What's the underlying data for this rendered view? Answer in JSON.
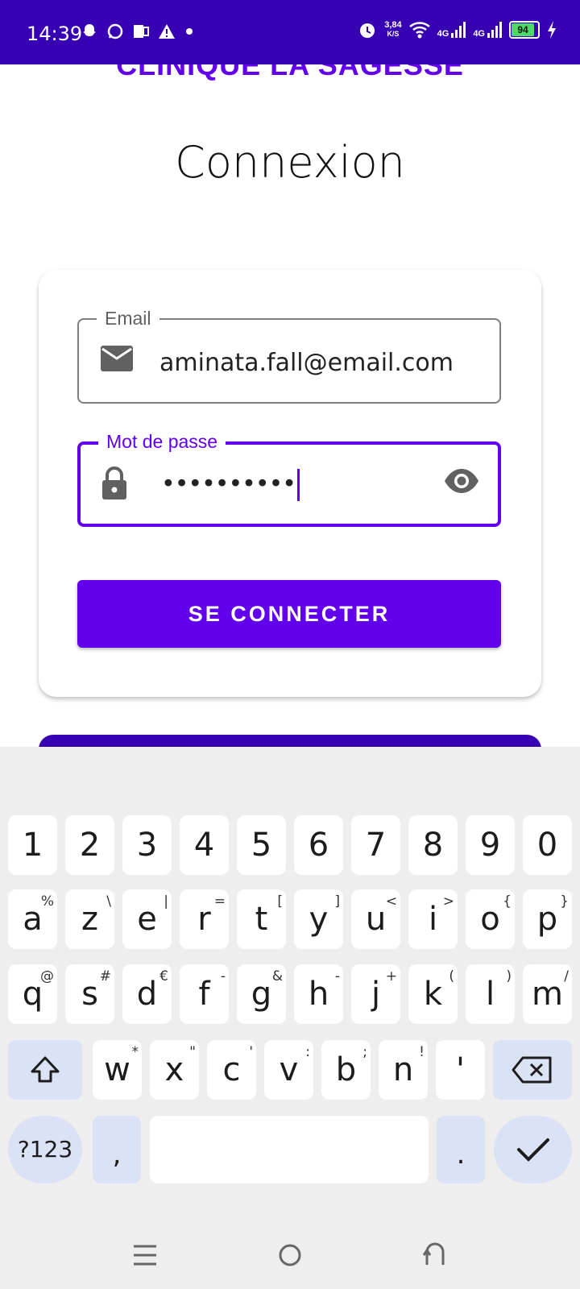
{
  "status_bar": {
    "time": "14:39",
    "net_speed_value": "3,84",
    "net_speed_unit": "K/S",
    "net1": "4G",
    "net2": "4G",
    "battery": "94",
    "icons_left": [
      "snapchat-icon",
      "whatsapp-icon",
      "outlook-icon",
      "warning-icon",
      "dot-icon"
    ],
    "icons_right": [
      "alarm-icon",
      "wifi-icon",
      "signal-icon",
      "signal-icon",
      "battery-icon",
      "charging-icon"
    ]
  },
  "app": {
    "brand": "CLINIQUE LA SAGESSE",
    "title": "Connexion",
    "email_label": "Email",
    "email_value": "aminata.fall@email.com",
    "password_label": "Mot de passe",
    "password_value": "••••••••••",
    "login_button": "SE CONNECTER",
    "accent_color": "#6200ee",
    "dark_accent_color": "#3700b3"
  },
  "keyboard": {
    "row_numbers": [
      "1",
      "2",
      "3",
      "4",
      "5",
      "6",
      "7",
      "8",
      "9",
      "0"
    ],
    "row1": [
      {
        "k": "a",
        "s": "%"
      },
      {
        "k": "z",
        "s": "\\"
      },
      {
        "k": "e",
        "s": "|"
      },
      {
        "k": "r",
        "s": "="
      },
      {
        "k": "t",
        "s": "["
      },
      {
        "k": "y",
        "s": "]"
      },
      {
        "k": "u",
        "s": "<"
      },
      {
        "k": "i",
        "s": ">"
      },
      {
        "k": "o",
        "s": "{"
      },
      {
        "k": "p",
        "s": "}"
      }
    ],
    "row2": [
      {
        "k": "q",
        "s": "@"
      },
      {
        "k": "s",
        "s": "#"
      },
      {
        "k": "d",
        "s": "€"
      },
      {
        "k": "f",
        "s": "-"
      },
      {
        "k": "g",
        "s": "&"
      },
      {
        "k": "h",
        "s": "-"
      },
      {
        "k": "j",
        "s": "+"
      },
      {
        "k": "k",
        "s": "("
      },
      {
        "k": "l",
        "s": ")"
      },
      {
        "k": "m",
        "s": "/"
      }
    ],
    "row3": [
      {
        "k": "w",
        "s": "*"
      },
      {
        "k": "x",
        "s": "\""
      },
      {
        "k": "c",
        "s": "'"
      },
      {
        "k": "v",
        "s": ":"
      },
      {
        "k": "b",
        "s": ";"
      },
      {
        "k": "n",
        "s": "!"
      },
      {
        "k": "'",
        "s": ""
      }
    ],
    "symbols_key": "?123",
    "comma_key": ",",
    "period_key": "."
  }
}
